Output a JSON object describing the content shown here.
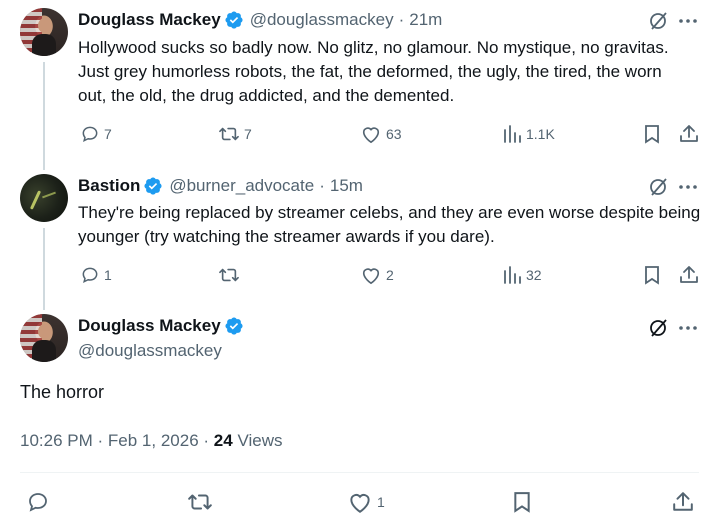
{
  "tweets": [
    {
      "name": "Douglass Mackey",
      "handle": "@douglassmackey",
      "dot": "·",
      "time": "21m",
      "text": "Hollywood sucks so badly now. No glitz, no glamour. No mystique, no gravitas. Just grey humorless robots, the fat, the deformed, the ugly, the tired, the worn out, the old, the drug addicted, and the demented.",
      "replies": "7",
      "reposts": "7",
      "likes": "63",
      "views": "1.1K"
    },
    {
      "name": "Bastion",
      "handle": "@burner_advocate",
      "dot": "·",
      "time": "15m",
      "text": "They're being replaced by streamer celebs, and they are even worse despite being younger (try watching the streamer awards if you dare).",
      "replies": "1",
      "reposts": "",
      "likes": "2",
      "views": "32"
    }
  ],
  "main": {
    "name": "Douglass Mackey",
    "handle": "@douglassmackey",
    "text": "The horror",
    "time": "10:26 PM",
    "sep1": "·",
    "date": "Feb 1, 2026",
    "sep2": "·",
    "views_count": "24",
    "views_label": "Views",
    "likes": "1"
  },
  "colors": {
    "verified": "#1d9bf0",
    "text": "#0f1419",
    "secondary": "#536471",
    "line": "#cfd9de"
  },
  "icons": {
    "reply": "reply-icon",
    "repost": "repost-icon",
    "like": "heart-icon",
    "views": "views-icon",
    "bookmark": "bookmark-icon",
    "share": "share-icon",
    "grok": "grok-icon",
    "more": "more-icon"
  }
}
